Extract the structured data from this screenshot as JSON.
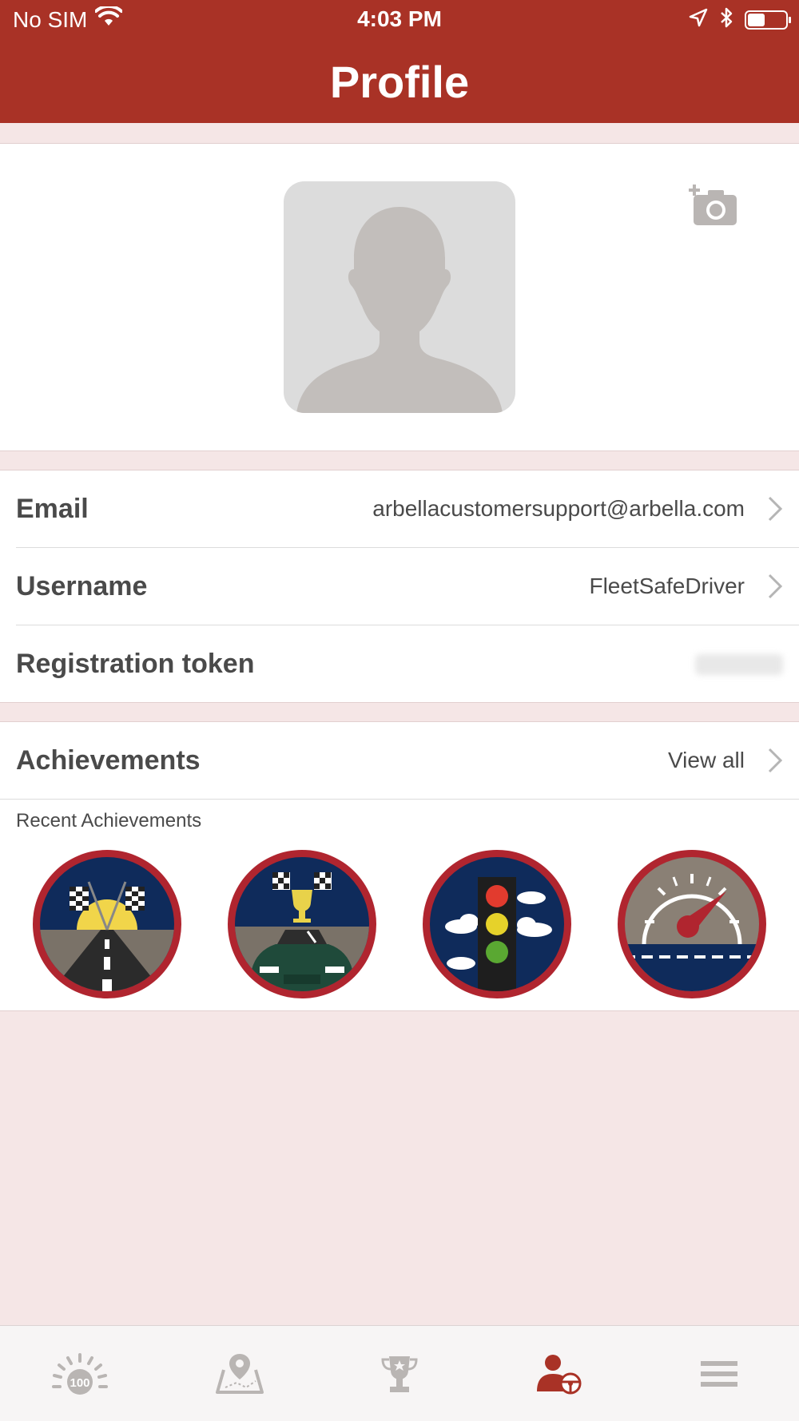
{
  "status_bar": {
    "carrier": "No SIM",
    "time": "4:03 PM",
    "battery_level": 0.45
  },
  "header": {
    "title": "Profile"
  },
  "profile": {
    "email_label": "Email",
    "email_value": "arbellacustomersupport@arbella.com",
    "username_label": "Username",
    "username_value": "FleetSafeDriver",
    "token_label": "Registration token"
  },
  "achievements": {
    "title": "Achievements",
    "view_all": "View all",
    "recent_label": "Recent Achievements",
    "badges": [
      "finish-line-road-badge-icon",
      "trophy-car-badge-icon",
      "traffic-light-badge-icon",
      "speedometer-badge-icon"
    ]
  },
  "tabbar": {
    "items": [
      "score-100-icon",
      "map-pin-icon",
      "trophy-icon",
      "profile-driver-icon",
      "menu-icon"
    ],
    "active_index": 3
  },
  "colors": {
    "brand": "#a93226",
    "background": "#f5e6e6",
    "badge_border": "#b0252f",
    "badge_navy": "#0f2b5b"
  }
}
